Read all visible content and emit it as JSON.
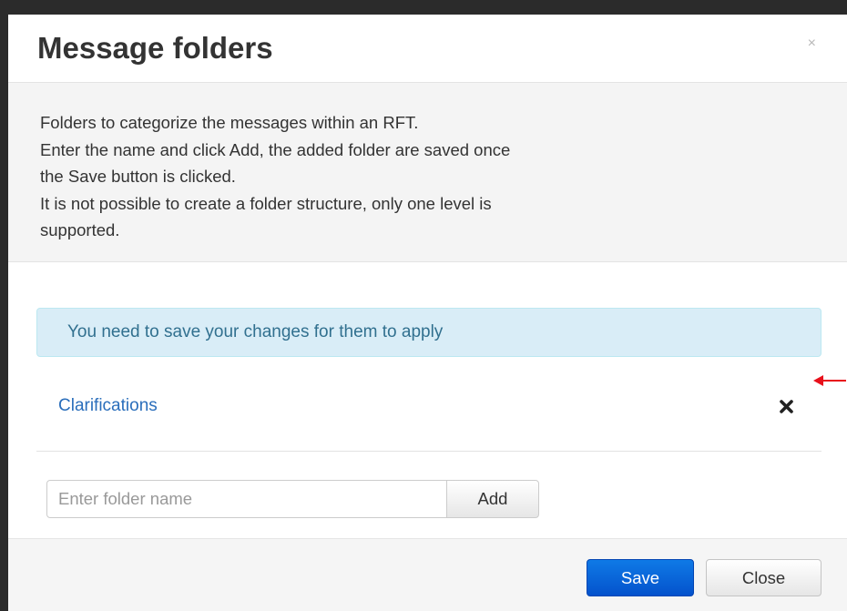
{
  "modal": {
    "title": "Message folders",
    "close_glyph": "×"
  },
  "info": {
    "lines": [
      "Folders to categorize the messages within an RFT.",
      "Enter the name and click Add, the added folder are saved once",
      "the Save button is clicked.",
      "It is not possible to create a folder structure, only one level is",
      "supported."
    ]
  },
  "alert": {
    "text": "You need to save your changes for them to apply"
  },
  "folders": [
    {
      "name": "Clarifications",
      "remove_icon": "remove-icon"
    }
  ],
  "add_folder": {
    "placeholder": "Enter folder name",
    "value": "",
    "button_label": "Add"
  },
  "footer": {
    "save_label": "Save",
    "close_label": "Close"
  },
  "colors": {
    "primary": "#0452cc",
    "link": "#2a6ebb",
    "alert_bg": "#d9edf7",
    "alert_text": "#31708f",
    "annotation": "#e8101b"
  }
}
